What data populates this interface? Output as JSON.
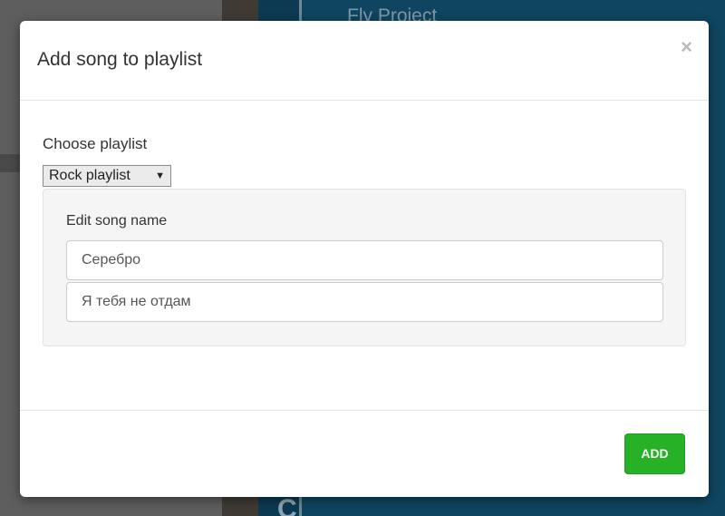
{
  "background": {
    "now_playing_artist": "Fly Project",
    "section_letter": "C"
  },
  "modal": {
    "title": "Add song to playlist",
    "close_symbol": "×",
    "choose_label": "Choose playlist",
    "playlist_select": {
      "selected": "Rock playlist",
      "arrow": "▼"
    },
    "edit_label": "Edit song name",
    "artist_value": "Серебро",
    "song_value": "Я тебя не отдам",
    "add_button": "ADD"
  },
  "colors": {
    "accent": "#27b127",
    "overlay_blue": "#0f4560"
  }
}
